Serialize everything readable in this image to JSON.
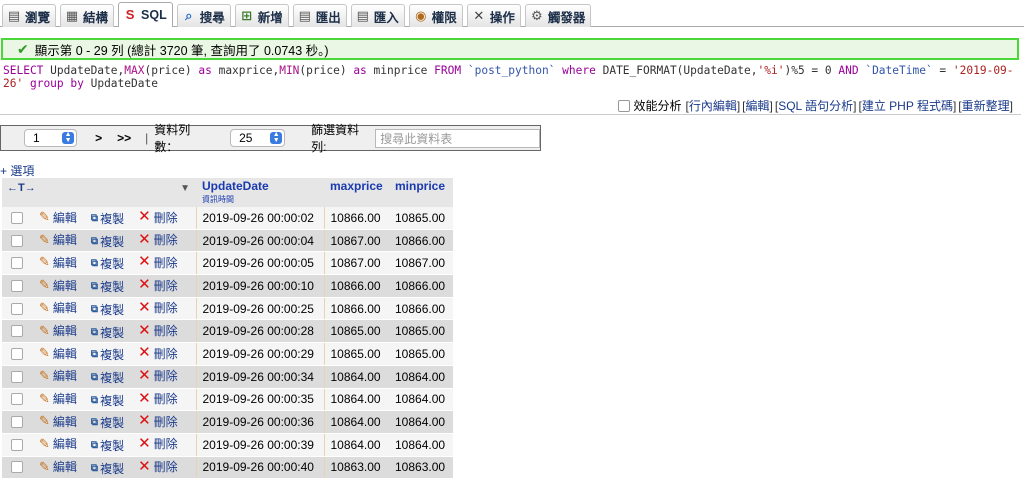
{
  "tabs": [
    {
      "label": "瀏覽",
      "icon": "browse-icon",
      "active": false
    },
    {
      "label": "結構",
      "icon": "structure-icon",
      "active": false
    },
    {
      "label": "SQL",
      "icon": "sql-icon",
      "active": true
    },
    {
      "label": "搜尋",
      "icon": "search-icon",
      "active": false
    },
    {
      "label": "新增",
      "icon": "insert-icon",
      "active": false
    },
    {
      "label": "匯出",
      "icon": "export-icon",
      "active": false
    },
    {
      "label": "匯入",
      "icon": "import-icon",
      "active": false
    },
    {
      "label": "權限",
      "icon": "privileges-icon",
      "active": false
    },
    {
      "label": "操作",
      "icon": "operations-icon",
      "active": false
    },
    {
      "label": "觸發器",
      "icon": "triggers-icon",
      "active": false
    }
  ],
  "message": {
    "text": "顯示第 0 - 29 列 (總計 3720 筆, 查詢用了 0.0743 秒。)",
    "status_color": "#49d837"
  },
  "sql": {
    "parts": [
      {
        "t": "SELECT",
        "c": "kw"
      },
      {
        "t": " UpdateDate,",
        "c": "op"
      },
      {
        "t": "MAX",
        "c": "fn"
      },
      {
        "t": "(price) ",
        "c": "op"
      },
      {
        "t": "as",
        "c": "kw"
      },
      {
        "t": " maxprice,",
        "c": "op"
      },
      {
        "t": "MIN",
        "c": "fn"
      },
      {
        "t": "(price) ",
        "c": "op"
      },
      {
        "t": "as",
        "c": "kw"
      },
      {
        "t": " minprice ",
        "c": "op"
      },
      {
        "t": "FROM",
        "c": "kw"
      },
      {
        "t": " ",
        "c": "op"
      },
      {
        "t": "`post_python`",
        "c": "bt"
      },
      {
        "t": " ",
        "c": "op"
      },
      {
        "t": "where",
        "c": "kw"
      },
      {
        "t": " DATE_FORMAT(UpdateDate,",
        "c": "op"
      },
      {
        "t": "'%i'",
        "c": "str"
      },
      {
        "t": ")%5 = 0 ",
        "c": "op"
      },
      {
        "t": "AND",
        "c": "kw"
      },
      {
        "t": " ",
        "c": "op"
      },
      {
        "t": "`DateTime`",
        "c": "bt"
      },
      {
        "t": " = ",
        "c": "op"
      },
      {
        "t": "'2019-09-26'",
        "c": "str"
      },
      {
        "t": " ",
        "c": "op"
      },
      {
        "t": "group by",
        "c": "kw"
      },
      {
        "t": " UpdateDate",
        "c": "op"
      }
    ],
    "profiling_label": "效能分析",
    "links": [
      "行內編輯",
      "編輯",
      "SQL 語句分析",
      "建立 PHP 程式碼",
      "重新整理"
    ]
  },
  "nav": {
    "page_value": "1",
    "next_label": ">",
    "last_label": ">>",
    "pipe": "|",
    "rows_label": "資料列數：",
    "rows_value": "25",
    "filter_label": "篩選資料列:",
    "filter_placeholder": "搜尋此資料表"
  },
  "options_label": "+ 選項",
  "table": {
    "arrows_label": "←T→",
    "columns": [
      {
        "name": "UpdateDate",
        "sub": "資訊時間"
      },
      {
        "name": "maxprice",
        "sub": ""
      },
      {
        "name": "minprice",
        "sub": ""
      }
    ],
    "actions": {
      "edit": "編輯",
      "copy": "複製",
      "delete": "刪除"
    },
    "rows": [
      [
        "2019-09-26 00:00:02",
        "10866.00",
        "10865.00"
      ],
      [
        "2019-09-26 00:00:04",
        "10867.00",
        "10866.00"
      ],
      [
        "2019-09-26 00:00:05",
        "10867.00",
        "10867.00"
      ],
      [
        "2019-09-26 00:00:10",
        "10866.00",
        "10866.00"
      ],
      [
        "2019-09-26 00:00:25",
        "10866.00",
        "10866.00"
      ],
      [
        "2019-09-26 00:00:28",
        "10865.00",
        "10865.00"
      ],
      [
        "2019-09-26 00:00:29",
        "10865.00",
        "10865.00"
      ],
      [
        "2019-09-26 00:00:34",
        "10864.00",
        "10864.00"
      ],
      [
        "2019-09-26 00:00:35",
        "10864.00",
        "10864.00"
      ],
      [
        "2019-09-26 00:00:36",
        "10864.00",
        "10864.00"
      ],
      [
        "2019-09-26 00:00:39",
        "10864.00",
        "10864.00"
      ],
      [
        "2019-09-26 00:00:40",
        "10863.00",
        "10863.00"
      ]
    ]
  }
}
